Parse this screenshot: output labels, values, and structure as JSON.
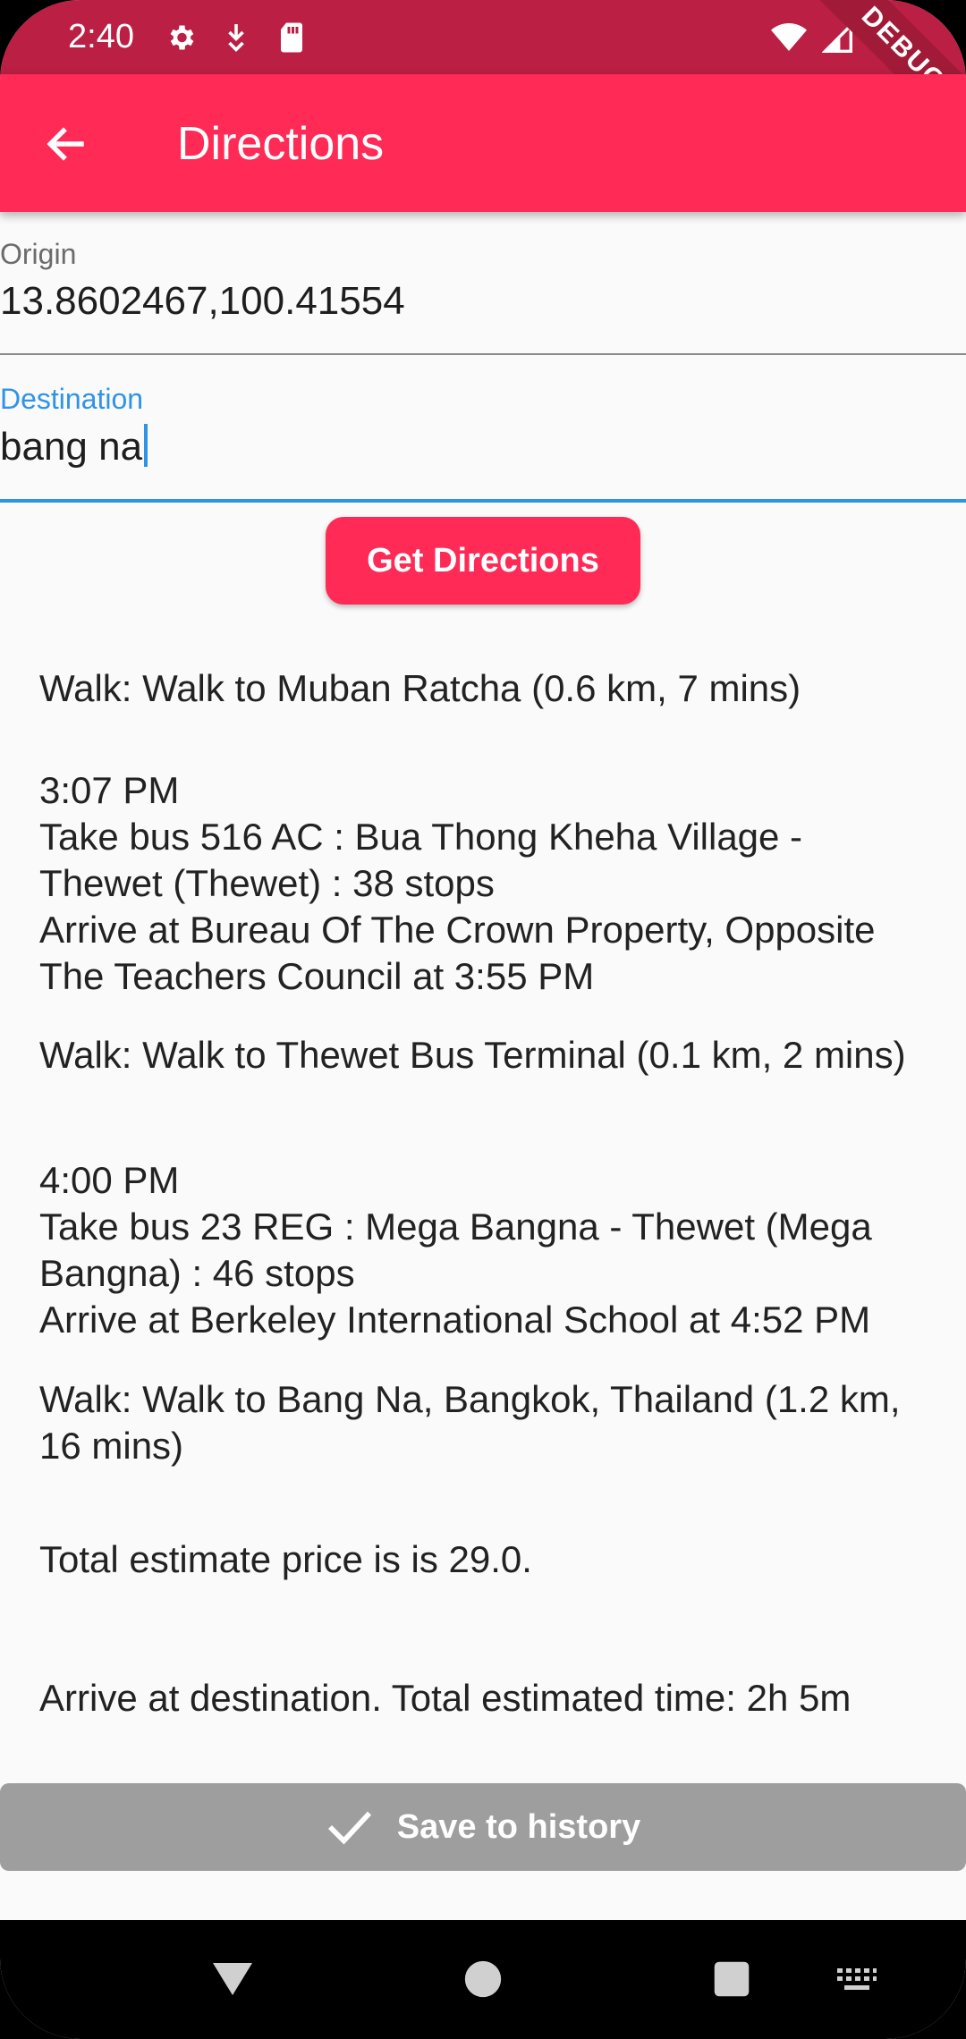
{
  "status_bar": {
    "time": "2:40",
    "debug_label": "DEBUG"
  },
  "app_bar": {
    "title": "Directions"
  },
  "origin": {
    "label": "Origin",
    "value": "13.8602467,100.41554"
  },
  "destination": {
    "label": "Destination",
    "value": "bang na"
  },
  "get_directions_label": "Get Directions",
  "steps": [
    "Walk: Walk to Muban Ratcha (0.6 km, 7 mins)",
    "3:07 PM\nTake bus 516 AC : Bua Thong Kheha Village - Thewet (Thewet) : 38 stops\nArrive at Bureau Of The Crown Property, Opposite The Teachers Council at 3:55 PM",
    "Walk: Walk to Thewet Bus Terminal (0.1 km, 2 mins)",
    "4:00 PM\nTake bus 23 REG : Mega Bangna - Thewet (Mega Bangna) : 46 stops\nArrive at Berkeley International School at 4:52 PM",
    "Walk: Walk to Bang Na, Bangkok, Thailand (1.2 km, 16 mins)"
  ],
  "total_price": "Total estimate price is is 29.0.",
  "arrival": "Arrive at destination. Total estimated time: 2h 5m",
  "save_label": "Save to history",
  "colors": {
    "primary": "#ff2a55",
    "status_bar": "#bb1f43",
    "focus": "#2f93e8",
    "disabled": "#9e9e9e"
  }
}
